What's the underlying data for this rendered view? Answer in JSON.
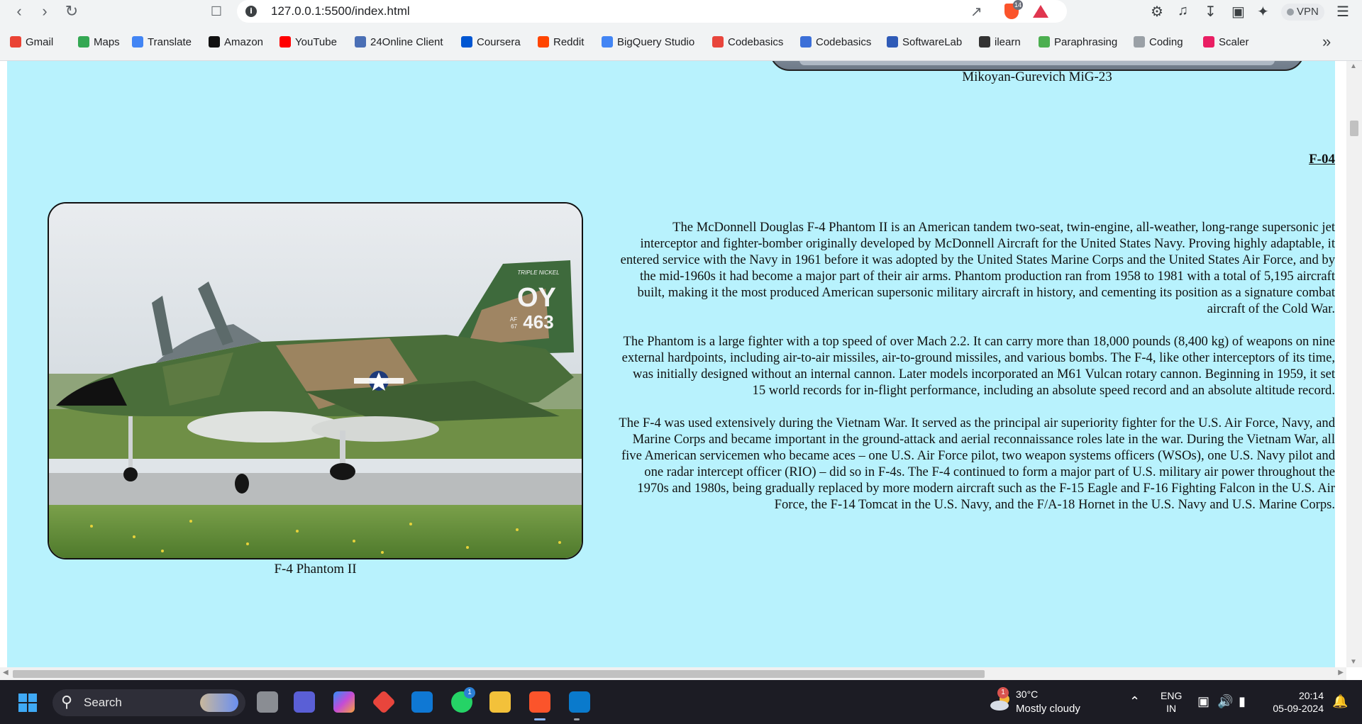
{
  "browser": {
    "url": "127.0.0.1:5500/index.html",
    "shield_count": "14",
    "vpn_label": "VPN"
  },
  "bookmarks": [
    {
      "label": "Gmail",
      "color": "#ea4335"
    },
    {
      "label": "Maps",
      "color": "#34a853"
    },
    {
      "label": "Translate",
      "color": "#4285f4"
    },
    {
      "label": "Amazon",
      "color": "#111111"
    },
    {
      "label": "YouTube",
      "color": "#ff0000"
    },
    {
      "label": "24Online Client",
      "color": "#4a6fb5"
    },
    {
      "label": "Coursera",
      "color": "#0056d2"
    },
    {
      "label": "Reddit",
      "color": "#ff4500"
    },
    {
      "label": "BigQuery Studio",
      "color": "#4285f4"
    },
    {
      "label": "Codebasics",
      "color": "#e8453c"
    },
    {
      "label": "Codebasics",
      "color": "#3b6fd8"
    },
    {
      "label": "SoftwareLab",
      "color": "#2f5bb7"
    },
    {
      "label": "ilearn",
      "color": "#333333"
    },
    {
      "label": "Paraphrasing",
      "color": "#4caf50"
    },
    {
      "label": "Coding",
      "color": "#9aa0a6"
    },
    {
      "label": "Scaler",
      "color": "#e91e63"
    }
  ],
  "page": {
    "prev_caption": "Mikoyan-Gurevich MiG-23",
    "section_heading": "F-04",
    "image_caption": "F-4 Phantom II",
    "aircraft_markings": {
      "code": "OY",
      "serial": "463",
      "af_prefix": "AF",
      "af_year": "67",
      "tail_name": "TRIPLE NICKEL"
    },
    "paragraphs": [
      "The McDonnell Douglas F-4 Phantom II is an American tandem two-seat, twin-engine, all-weather, long-range supersonic jet interceptor and fighter-bomber originally developed by McDonnell Aircraft for the United States Navy. Proving highly adaptable, it entered service with the Navy in 1961 before it was adopted by the United States Marine Corps and the United States Air Force, and by the mid-1960s it had become a major part of their air arms. Phantom production ran from 1958 to 1981 with a total of 5,195 aircraft built, making it the most produced American supersonic military aircraft in history, and cementing its position as a signature combat aircraft of the Cold War.",
      "The Phantom is a large fighter with a top speed of over Mach 2.2. It can carry more than 18,000 pounds (8,400 kg) of weapons on nine external hardpoints, including air-to-air missiles, air-to-ground missiles, and various bombs. The F-4, like other interceptors of its time, was initially designed without an internal cannon. Later models incorporated an M61 Vulcan rotary cannon. Beginning in 1959, it set 15 world records for in-flight performance, including an absolute speed record and an absolute altitude record.",
      "The F-4 was used extensively during the Vietnam War. It served as the principal air superiority fighter for the U.S. Air Force, Navy, and Marine Corps and became important in the ground-attack and aerial reconnaissance roles late in the war. During the Vietnam War, all five American servicemen who became aces – one U.S. Air Force pilot, two weapon systems officers (WSOs), one U.S. Navy pilot and one radar intercept officer (RIO) – did so in F-4s. The F-4 continued to form a major part of U.S. military air power throughout the 1970s and 1980s, being gradually replaced by more modern aircraft such as the F-15 Eagle and F-16 Fighting Falcon in the U.S. Air Force, the F-14 Tomcat in the U.S. Navy, and the F/A-18 Hornet in the U.S. Navy and U.S. Marine Corps."
    ]
  },
  "taskbar": {
    "search_label": "Search",
    "whatsapp_badge": "1",
    "weather_badge": "1",
    "weather_temp": "30°C",
    "weather_desc": "Mostly cloudy",
    "lang_line1": "ENG",
    "lang_line2": "IN",
    "time": "20:14",
    "date": "05-09-2024"
  },
  "colors": {
    "page_background": "#b8f2fd",
    "taskbar": "#1c1c24"
  }
}
